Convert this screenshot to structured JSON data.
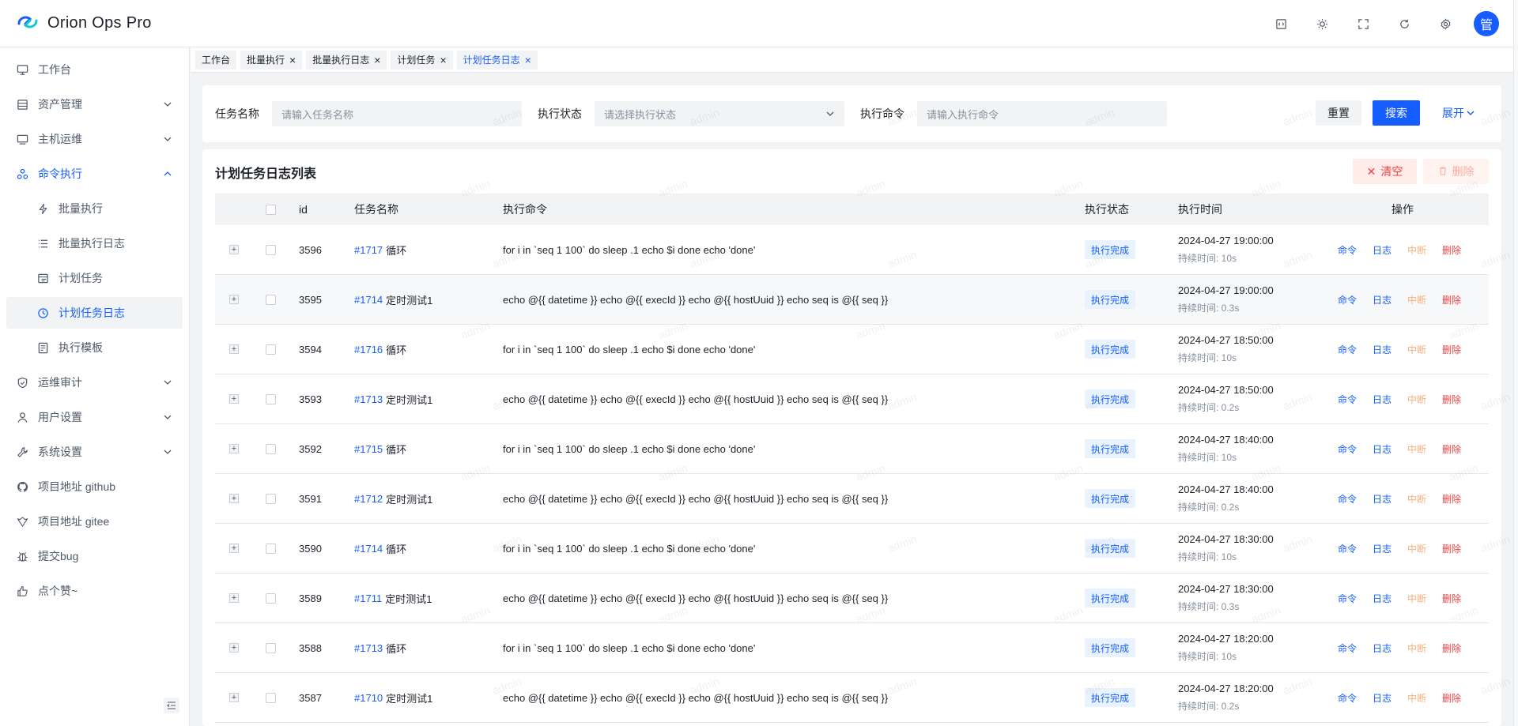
{
  "app": {
    "title": "Orion Ops Pro",
    "avatar_text": "管"
  },
  "header_icons": [
    "docs-icon",
    "theme-icon",
    "fullscreen-icon",
    "refresh-icon",
    "settings-icon"
  ],
  "sidebar": {
    "items": [
      {
        "label": "工作台",
        "icon": "monitor-icon",
        "arrow": ""
      },
      {
        "label": "资产管理",
        "icon": "asset-icon",
        "arrow": "down"
      },
      {
        "label": "主机运维",
        "icon": "host-icon",
        "arrow": "down"
      },
      {
        "label": "命令执行",
        "icon": "command-icon",
        "arrow": "up",
        "active": true
      },
      {
        "label": "批量执行",
        "icon": "lightning-icon",
        "sub": true
      },
      {
        "label": "批量执行日志",
        "icon": "list-icon",
        "sub": true
      },
      {
        "label": "计划任务",
        "icon": "calendar-icon",
        "sub": true
      },
      {
        "label": "计划任务日志",
        "icon": "history-icon",
        "sub": true,
        "selected": true
      },
      {
        "label": "执行模板",
        "icon": "template-icon",
        "sub": true
      },
      {
        "label": "运维审计",
        "icon": "shield-icon",
        "arrow": "down"
      },
      {
        "label": "用户设置",
        "icon": "user-icon",
        "arrow": "down"
      },
      {
        "label": "系统设置",
        "icon": "wrench-icon",
        "arrow": "down"
      },
      {
        "label": "项目地址 github",
        "icon": "github-icon",
        "arrow": ""
      },
      {
        "label": "项目地址 gitee",
        "icon": "gitee-icon",
        "arrow": ""
      },
      {
        "label": "提交bug",
        "icon": "bug-icon",
        "arrow": ""
      },
      {
        "label": "点个赞~",
        "icon": "like-icon",
        "arrow": ""
      }
    ]
  },
  "tabs": [
    {
      "label": "工作台",
      "closable": false,
      "active": false
    },
    {
      "label": "批量执行",
      "closable": true,
      "active": false
    },
    {
      "label": "批量执行日志",
      "closable": true,
      "active": false
    },
    {
      "label": "计划任务",
      "closable": true,
      "active": false
    },
    {
      "label": "计划任务日志",
      "closable": true,
      "active": true
    }
  ],
  "search": {
    "task_name_label": "任务名称",
    "task_name_placeholder": "请输入任务名称",
    "status_label": "执行状态",
    "status_placeholder": "请选择执行状态",
    "command_label": "执行命令",
    "command_placeholder": "请输入执行命令",
    "reset_label": "重置",
    "search_label": "搜索",
    "expand_label": "展开"
  },
  "table": {
    "title": "计划任务日志列表",
    "clear_label": "清空",
    "delete_label": "删除",
    "columns": {
      "id": "id",
      "task": "任务名称",
      "command": "执行命令",
      "status": "执行状态",
      "time": "执行时间",
      "ops": "操作"
    },
    "op_labels": {
      "command": "命令",
      "log": "日志",
      "interrupt": "中断",
      "delete": "删除"
    },
    "watermark_text": "admin",
    "rows": [
      {
        "id": "3596",
        "task_id": "#1717",
        "task_name": "循环",
        "command": "for i in `seq 1 100` do sleep .1 echo $i done echo 'done'",
        "status": "执行完成",
        "time": "2024-04-27 19:00:00",
        "duration": "持续时间: 10s"
      },
      {
        "id": "3595",
        "task_id": "#1714",
        "task_name": "定时测试1",
        "command": "echo @{{ datetime }} echo @{{ execId }} echo @{{ hostUuid }} echo seq is @{{ seq }}",
        "status": "执行完成",
        "time": "2024-04-27 19:00:00",
        "duration": "持续时间: 0.3s"
      },
      {
        "id": "3594",
        "task_id": "#1716",
        "task_name": "循环",
        "command": "for i in `seq 1 100` do sleep .1 echo $i done echo 'done'",
        "status": "执行完成",
        "time": "2024-04-27 18:50:00",
        "duration": "持续时间: 10s"
      },
      {
        "id": "3593",
        "task_id": "#1713",
        "task_name": "定时测试1",
        "command": "echo @{{ datetime }} echo @{{ execId }} echo @{{ hostUuid }} echo seq is @{{ seq }}",
        "status": "执行完成",
        "time": "2024-04-27 18:50:00",
        "duration": "持续时间: 0.2s"
      },
      {
        "id": "3592",
        "task_id": "#1715",
        "task_name": "循环",
        "command": "for i in `seq 1 100` do sleep .1 echo $i done echo 'done'",
        "status": "执行完成",
        "time": "2024-04-27 18:40:00",
        "duration": "持续时间: 10s"
      },
      {
        "id": "3591",
        "task_id": "#1712",
        "task_name": "定时测试1",
        "command": "echo @{{ datetime }} echo @{{ execId }} echo @{{ hostUuid }} echo seq is @{{ seq }}",
        "status": "执行完成",
        "time": "2024-04-27 18:40:00",
        "duration": "持续时间: 0.2s"
      },
      {
        "id": "3590",
        "task_id": "#1714",
        "task_name": "循环",
        "command": "for i in `seq 1 100` do sleep .1 echo $i done echo 'done'",
        "status": "执行完成",
        "time": "2024-04-27 18:30:00",
        "duration": "持续时间: 10s"
      },
      {
        "id": "3589",
        "task_id": "#1711",
        "task_name": "定时测试1",
        "command": "echo @{{ datetime }} echo @{{ execId }} echo @{{ hostUuid }} echo seq is @{{ seq }}",
        "status": "执行完成",
        "time": "2024-04-27 18:30:00",
        "duration": "持续时间: 0.3s"
      },
      {
        "id": "3588",
        "task_id": "#1713",
        "task_name": "循环",
        "command": "for i in `seq 1 100` do sleep .1 echo $i done echo 'done'",
        "status": "执行完成",
        "time": "2024-04-27 18:20:00",
        "duration": "持续时间: 10s"
      },
      {
        "id": "3587",
        "task_id": "#1710",
        "task_name": "定时测试1",
        "command": "echo @{{ datetime }} echo @{{ execId }} echo @{{ hostUuid }} echo seq is @{{ seq }}",
        "status": "执行完成",
        "time": "2024-04-27 18:20:00",
        "duration": "持续时间: 0.2s"
      }
    ]
  },
  "colors": {
    "primary": "#165dff",
    "danger": "#f53f3f",
    "warning": "#fdae7a",
    "tag_bg": "#e8f3ff"
  }
}
